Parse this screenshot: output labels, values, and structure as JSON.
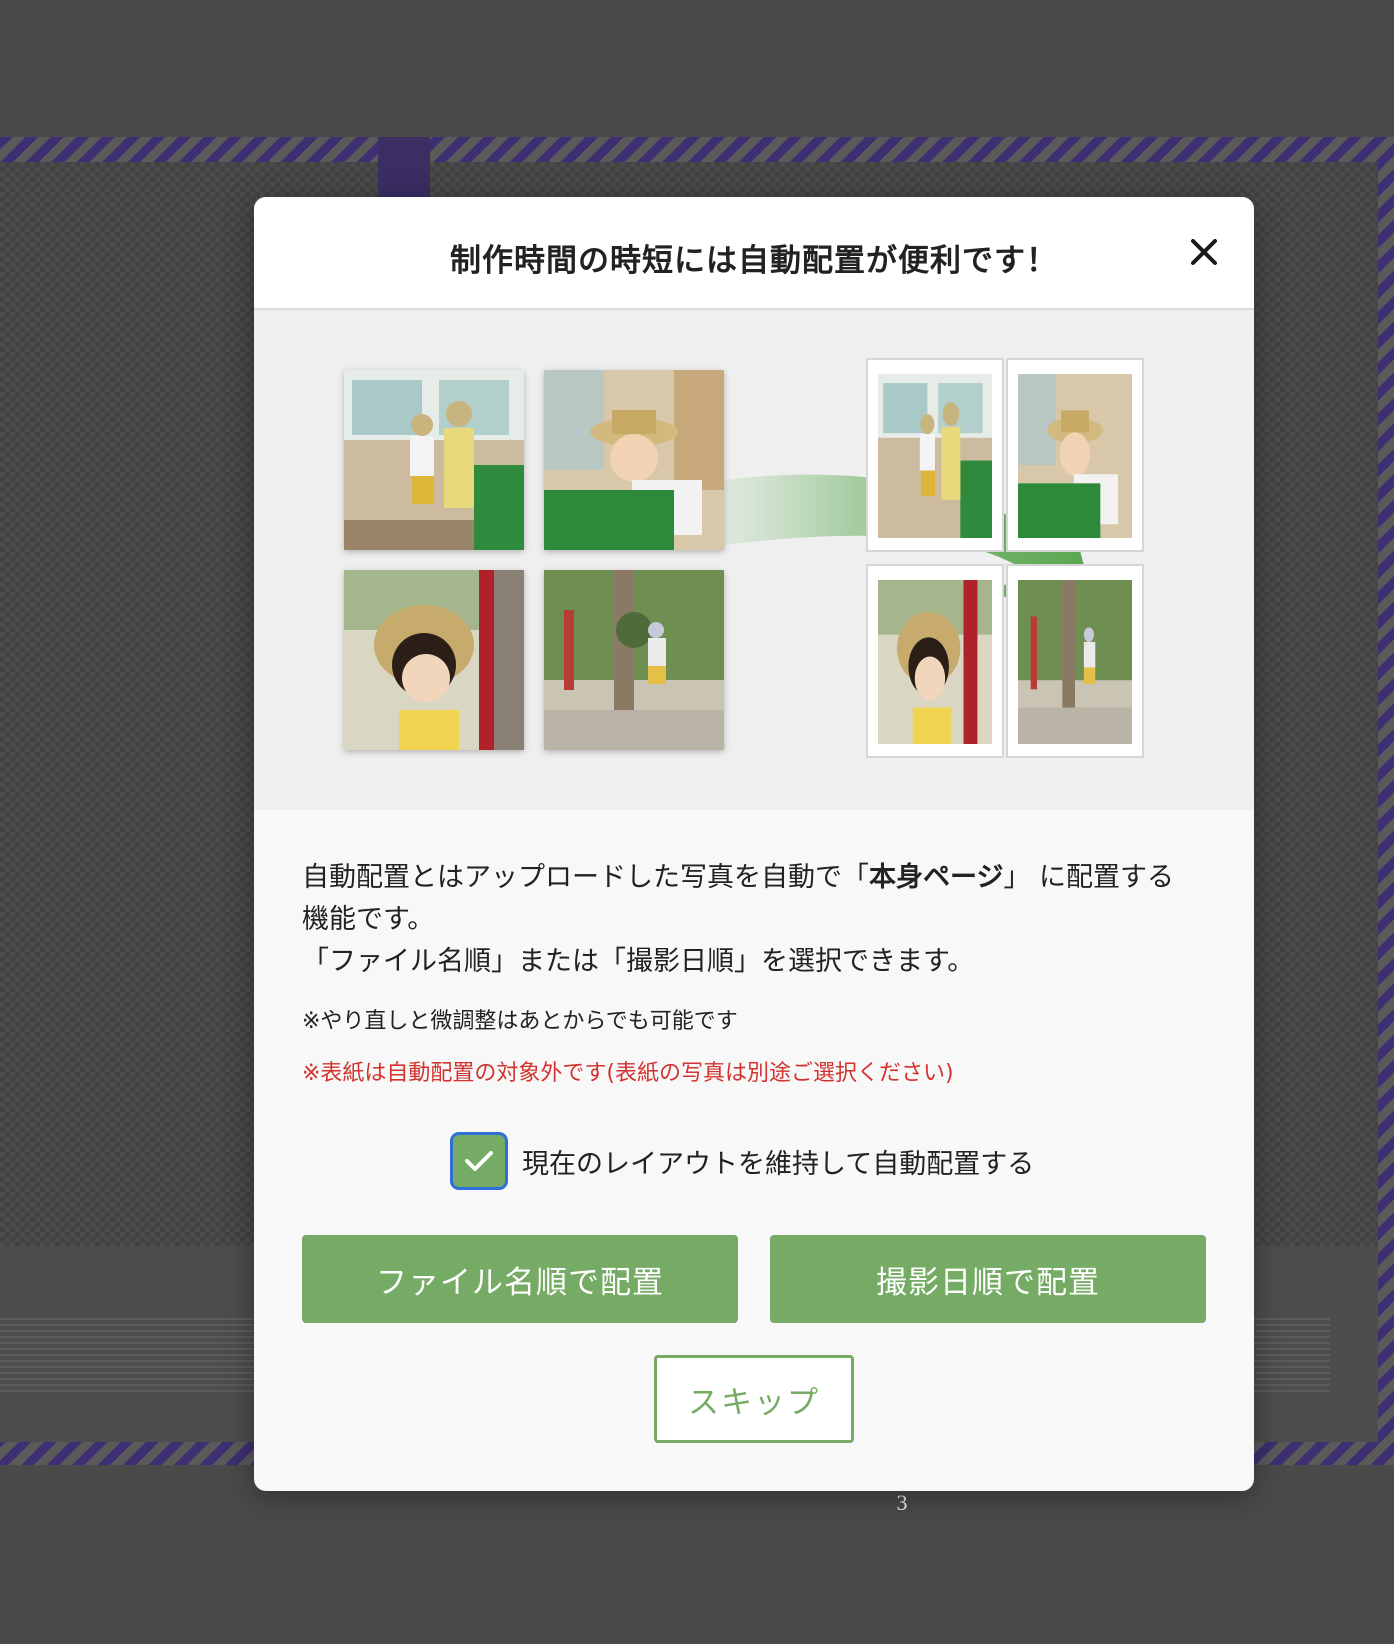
{
  "page": {
    "page_number": "3"
  },
  "modal": {
    "title": "制作時間の時短には自動配置が便利です！",
    "close_icon": "close-icon",
    "description": {
      "line1_pre": "自動配置とはアップロードした写真を自動で「",
      "line1_bold": "本身ページ",
      "line1_post": "」 に配置する",
      "line2": "機能です。",
      "line3": "「ファイル名順」または「撮影日順」を選択できます。"
    },
    "note": "※やり直しと微調整はあとからでも可能です",
    "warning": "※表紙は自動配置の対象外です(表紙の写真は別途ご選択ください)",
    "checkbox": {
      "label": "現在のレイアウトを維持して自動配置する",
      "checked": true
    },
    "buttons": {
      "filename": "ファイル名順で配置",
      "date": "撮影日順で配置",
      "skip": "スキップ"
    }
  },
  "colors": {
    "accent_green": "#76ab66",
    "warning_red": "#d2332f",
    "focus_blue": "#2e6fd8"
  },
  "illustration": {
    "photos": [
      "photo-train-window-kids",
      "photo-boy-leaning-seat",
      "photo-girl-hugging-pole",
      "photo-boy-walking-shrine"
    ],
    "arrow_icon": "curved-arrow-icon"
  }
}
